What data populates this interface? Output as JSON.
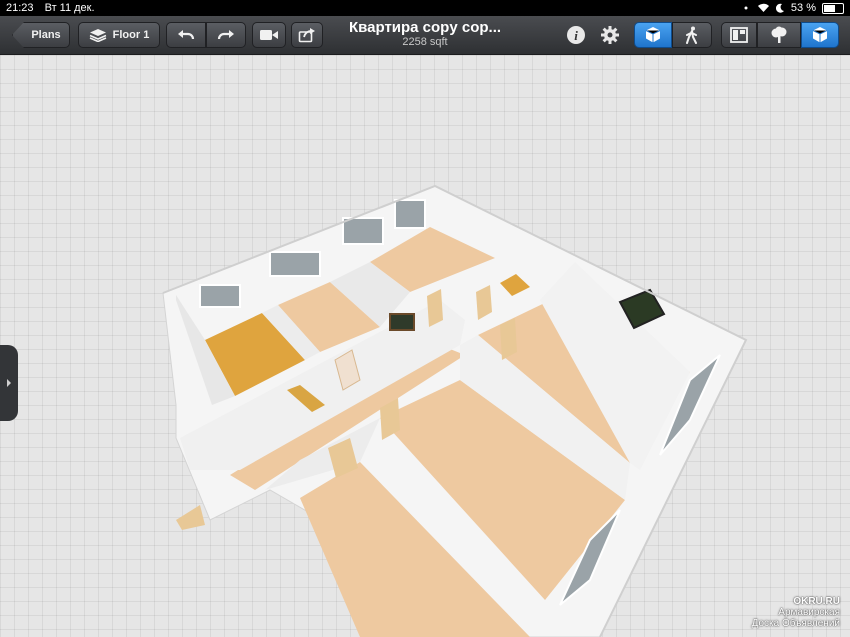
{
  "status_bar": {
    "time": "21:23",
    "date": "Вт 11 дек.",
    "battery": "53 %",
    "battery_level": 0.53
  },
  "toolbar": {
    "back_label": "Plans",
    "floor_label": "Floor 1",
    "title": "Квартира copy cop...",
    "subtitle": "2258 sqft",
    "view_3d_active": true
  },
  "watermark": {
    "line1": "OKRU.RU",
    "line2": "Армавирская",
    "line3": "Доска Объявлений"
  },
  "colors": {
    "accent_blue": "#2a86de",
    "floor_light": "#ecc9a0",
    "floor_dark": "#d9a543",
    "wall": "#f4f4f4"
  }
}
